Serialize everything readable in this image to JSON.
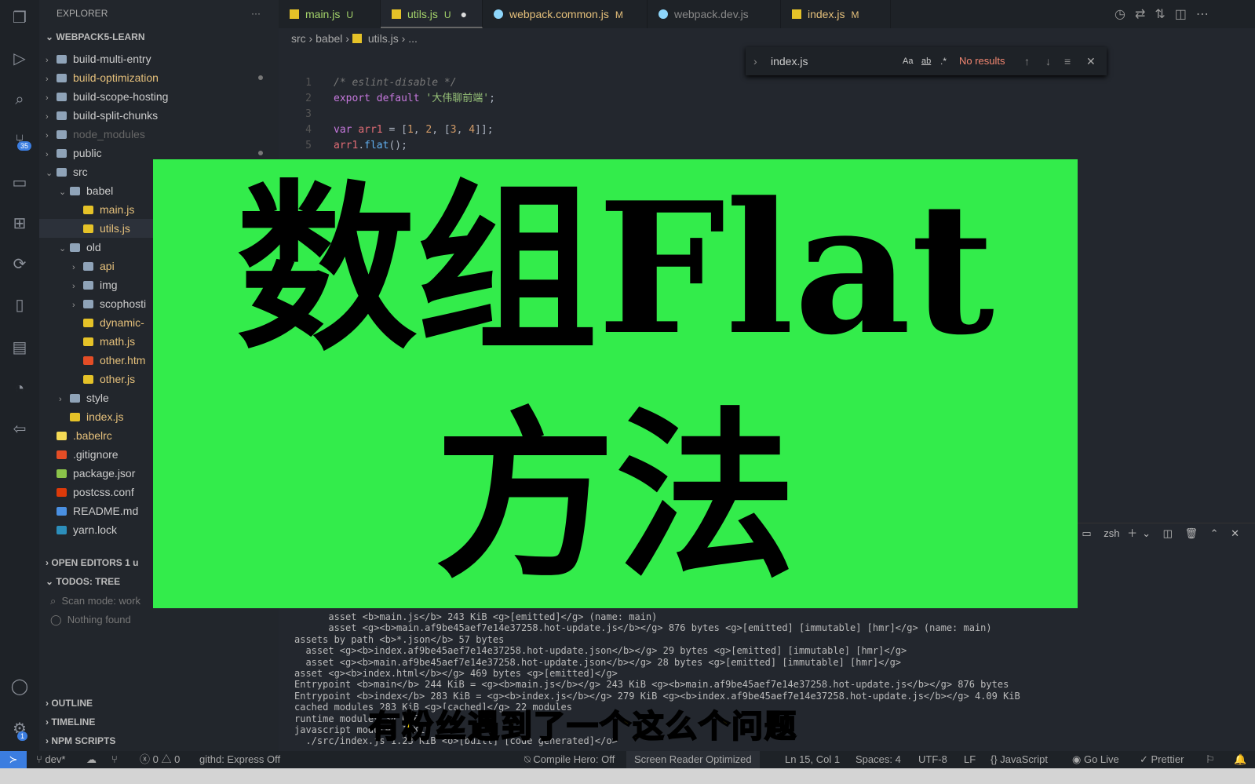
{
  "activity": {
    "scm_badge": "35",
    "account_badge": "1"
  },
  "sidebar": {
    "title": "EXPLORER",
    "more": "···",
    "root": "WEBPACK5-LEARN",
    "items": [
      {
        "label": "build-multi-entry",
        "type": "folder",
        "depth": 1,
        "open": false
      },
      {
        "label": "build-optimization",
        "type": "folder",
        "depth": 1,
        "open": false,
        "color": "#e5c07b",
        "dot": true
      },
      {
        "label": "build-scope-hosting",
        "type": "folder",
        "depth": 1,
        "open": false
      },
      {
        "label": "build-split-chunks",
        "type": "folder",
        "depth": 1,
        "open": false
      },
      {
        "label": "node_modules",
        "type": "folder",
        "depth": 1,
        "open": false,
        "color": "#666"
      },
      {
        "label": "public",
        "type": "folder",
        "depth": 1,
        "open": false,
        "dot": true
      },
      {
        "label": "src",
        "type": "folder",
        "depth": 1,
        "open": true
      },
      {
        "label": "babel",
        "type": "folder",
        "depth": 2,
        "open": true
      },
      {
        "label": "main.js",
        "type": "js",
        "depth": 3,
        "color": "#e5c07b"
      },
      {
        "label": "utils.js",
        "type": "js",
        "depth": 3,
        "color": "#e5c07b",
        "selected": true
      },
      {
        "label": "old",
        "type": "folder",
        "depth": 2,
        "open": true
      },
      {
        "label": "api",
        "type": "folder",
        "depth": 3,
        "open": false,
        "color": "#e5c07b"
      },
      {
        "label": "img",
        "type": "folder",
        "depth": 3,
        "open": false
      },
      {
        "label": "scophosti",
        "type": "folder",
        "depth": 3,
        "open": false
      },
      {
        "label": "dynamic-",
        "type": "js",
        "depth": 3,
        "leaf": true,
        "color": "#e5c07b"
      },
      {
        "label": "math.js",
        "type": "js",
        "depth": 3,
        "leaf": true,
        "color": "#e5c07b"
      },
      {
        "label": "other.htm",
        "type": "html",
        "depth": 3,
        "leaf": true,
        "color": "#e5c07b"
      },
      {
        "label": "other.js",
        "type": "js",
        "depth": 3,
        "leaf": true,
        "color": "#e5c07b"
      },
      {
        "label": "style",
        "type": "folder",
        "depth": 2,
        "open": false
      },
      {
        "label": "index.js",
        "type": "js",
        "depth": 2,
        "leaf": true,
        "color": "#e5c07b"
      },
      {
        "label": ".babelrc",
        "type": "babel",
        "depth": 1,
        "leaf": true,
        "color": "#e5c07b"
      },
      {
        "label": ".gitignore",
        "type": "git",
        "depth": 1,
        "leaf": true
      },
      {
        "label": "package.jsor",
        "type": "npm",
        "depth": 1,
        "leaf": true
      },
      {
        "label": "postcss.conf",
        "type": "postcss",
        "depth": 1,
        "leaf": true
      },
      {
        "label": "README.md",
        "type": "info",
        "depth": 1,
        "leaf": true
      },
      {
        "label": "yarn.lock",
        "type": "yarn",
        "depth": 1,
        "leaf": true
      }
    ],
    "open_editors": "OPEN EDITORS",
    "open_editors_badge": "1 u",
    "todos": "TODOS: TREE",
    "scan_mode": "Scan mode: work",
    "nothing": "Nothing found",
    "outline": "OUTLINE",
    "timeline": "TIMELINE",
    "npm": "NPM SCRIPTS"
  },
  "tabs": [
    {
      "label": "main.js",
      "flag": "U",
      "icon": "js",
      "color": "#a5d46b"
    },
    {
      "label": "utils.js",
      "flag": "U",
      "icon": "js",
      "color": "#a5d46b",
      "active": true,
      "dirty": "●"
    },
    {
      "label": "webpack.common.js",
      "flag": "M",
      "icon": "webpack",
      "color": "#e5c07b"
    },
    {
      "label": "webpack.dev.js",
      "flag": "",
      "icon": "webpack",
      "color": "#888"
    },
    {
      "label": "index.js",
      "flag": "M",
      "icon": "js",
      "color": "#e5c07b"
    }
  ],
  "breadcrumb": [
    "src",
    "babel",
    "utils.js",
    "..."
  ],
  "find": {
    "value": "index.js",
    "case": "Aa",
    "word": "ab",
    "regex": ".*",
    "result": "No results"
  },
  "code": [
    {
      "n": "1",
      "html": "<i style='color:#777'>/* eslint-disable */</i>"
    },
    {
      "n": "2",
      "html": "<span style='color:#c678dd'>export default</span> <span style='color:#98c379'>'大伟聊前端'</span>;"
    },
    {
      "n": "3",
      "html": ""
    },
    {
      "n": "4",
      "html": "<span style='color:#c678dd'>var</span> <span style='color:#e06c75'>arr1</span> = [<span style='color:#d19a66'>1</span>, <span style='color:#d19a66'>2</span>, [<span style='color:#d19a66'>3</span>, <span style='color:#d19a66'>4</span>]];"
    },
    {
      "n": "5",
      "html": "<span style='color:#e06c75'>arr1</span>.<span style='color:#61afef'>flat</span>();"
    }
  ],
  "terminal": {
    "shell": "zsh",
    "lines": [
      "      asset <b>main.js</b> 243 KiB <g>[emitted]</g> (name: main)",
      "      asset <g><b>main.af9be45aef7e14e37258.hot-update.js</b></g> 876 bytes <g>[emitted] [immutable] [hmr]</g> (name: main)",
      "assets by path <b>*.json</b> 57 bytes",
      "  asset <g><b>index.af9be45aef7e14e37258.hot-update.json</b></g> 29 bytes <g>[emitted] [immutable] [hmr]</g>",
      "  asset <g><b>main.af9be45aef7e14e37258.hot-update.json</b></g> 28 bytes <g>[emitted] [immutable] [hmr]</g>",
      "asset <g><b>index.html</b></g> 469 bytes <g>[emitted]</g>",
      "Entrypoint <b>main</b> 244 KiB = <g><b>main.js</b></g> 243 KiB <g><b>main.af9be45aef7e14e37258.hot-update.js</b></g> 876 bytes",
      "Entrypoint <b>index</b> 283 KiB = <g><b>index.js</b></g> 279 KiB <g><b>index.af9be45aef7e14e37258.hot-update.js</b></g> 4.09 KiB",
      "cached modules 283 KiB <g>[cached]</g> 22 modules",
      "runtime modules 34 KiB",
      "javascript modules 1 KiB",
      "  ./src/index.js 1.23 KiB <o>[built] [code generated]</o>"
    ]
  },
  "status": {
    "branch": "dev*",
    "errors": "0",
    "warnings": "0",
    "githd": "githd: Express Off",
    "compile": "Compile Hero: Off",
    "reader": "Screen Reader Optimized",
    "pos": "Ln 15, Col 1",
    "spaces": "Spaces: 4",
    "enc": "UTF-8",
    "eol": "LF",
    "lang": "JavaScript",
    "golive": "Go Live",
    "prettier": "Prettier"
  },
  "overlay": {
    "title_line1": "数组Flat",
    "title_line2": "方法",
    "subtitle": "有粉丝遇到了一个这么个问题",
    "bg": "#33ec4b"
  }
}
